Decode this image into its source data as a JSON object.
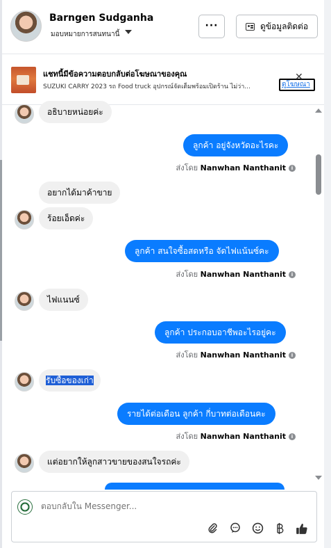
{
  "header": {
    "name": "Barngen Sudganha",
    "subtitle": "มอบหมายการสนทนานี้",
    "more_label": "···",
    "contact_label": "ดูข้อมูลติดต่อ"
  },
  "ad": {
    "title": "แชทนี้มีข้อความตอบกลับต่อโฆษณาของคุณ",
    "description": "SUZUKI CARRY 2023 รถ Food truck อุปกรณ์จัดเต็มพร้อมเปิดร้าน ไม่ว่า...",
    "link_label": "ดูโฆษณา",
    "close_label": "✕"
  },
  "messages": {
    "m1": "อธิบายหน่อยค่ะ",
    "m2": "ลูกค้า อยู่จังหวัดอะไรคะ",
    "m3": "อยากได้มาค้าขาย",
    "m4": "ร้อยเอ็ดค่ะ",
    "m5": "ลูกค้า  สนใจซื้อสดหรือ จัดไฟแน้นซ์คะ",
    "m6": "ไฟแนนซ์",
    "m7": "ลูกค้า ประกอบอาชีพอะไรอยู่คะ",
    "m8": "รับซื้อของเก่า",
    "m9": "รายได้ต่อเดือน  ลูกค้า  กี่บาทต่อเดือนคะ",
    "m10": "แต่อยากให้ลูกสาวขายของสนใจรถค่ะ"
  },
  "sent_by": {
    "prefix": "ส่งโดย",
    "sender": "Nanwhan Nanthanit",
    "info": "i"
  },
  "composer": {
    "placeholder": "ตอบกลับใน Messenger..."
  },
  "icons": {
    "attach": "paperclip-icon",
    "chat": "speech-bubble-icon",
    "emoji": "smiley-icon",
    "baht": "baht-icon",
    "like": "thumbs-up-icon"
  },
  "colors": {
    "outgoing_bubble": "#0a7cff",
    "incoming_bubble": "#f0f0f0",
    "selection_highlight": "#1f5fd6"
  }
}
